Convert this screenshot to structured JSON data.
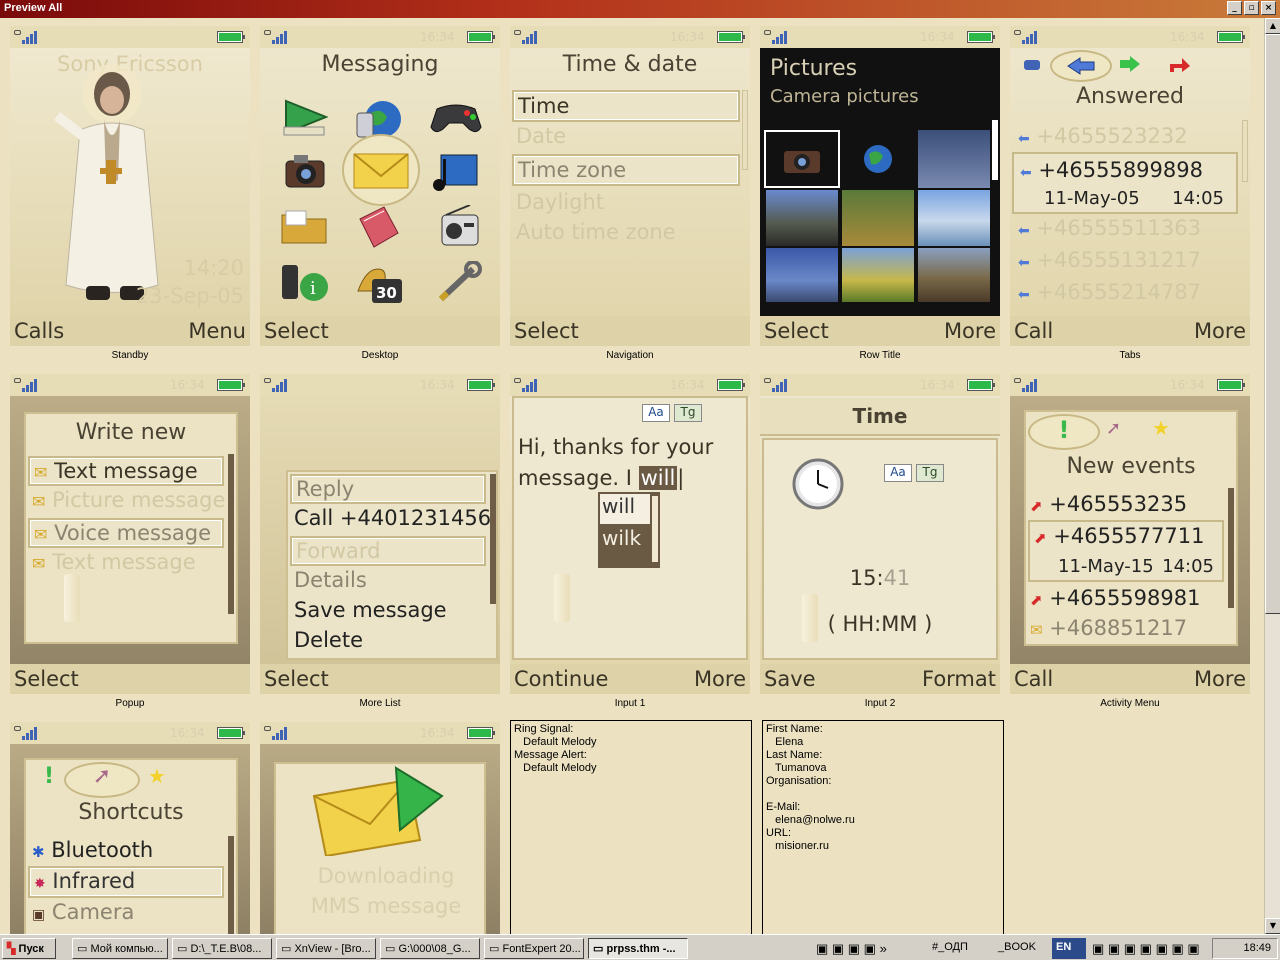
{
  "window": {
    "title": "Preview All",
    "btn_min": "_",
    "btn_max": "▫",
    "btn_close": "×"
  },
  "status_time": "16:34",
  "standby": {
    "brand": "Sony Ericsson",
    "time": "14:20",
    "date": "23-Sep-05",
    "left": "Calls",
    "right": "Menu",
    "caption": "Standby"
  },
  "desktop": {
    "title": "Messaging",
    "left": "Select",
    "caption": "Desktop"
  },
  "navigation": {
    "title": "Time & date",
    "items": [
      "Time",
      "Date",
      "Time zone",
      "Daylight",
      "Auto time zone"
    ],
    "left": "Select",
    "caption": "Navigation"
  },
  "rowtitle": {
    "title": "Pictures",
    "subtitle": "Camera pictures",
    "left": "Select",
    "right": "More",
    "caption": "Row Title"
  },
  "tabs": {
    "title": "Answered",
    "n1": "+4655523232",
    "n2": "+46555899898",
    "n2_date": "11-May-05",
    "n2_time": "14:05",
    "n3": "+46555511363",
    "n4": "+46555131217",
    "n5": "+46555214787",
    "left": "Call",
    "right": "More",
    "caption": "Tabs"
  },
  "popup": {
    "title": "Write new",
    "items": [
      "Text message",
      "Picture message",
      "Voice message",
      "Text message"
    ],
    "left": "Select",
    "caption": "Popup"
  },
  "morelist": {
    "items": [
      "Reply",
      "Call +4401231456",
      "Forward",
      "Details",
      "Save message",
      "Delete"
    ],
    "left": "Select",
    "caption": "More List"
  },
  "input1": {
    "mode1": "Aa",
    "mode2": "Tg",
    "text": "Hi, thanks for your message. I",
    "typed": "will",
    "sugg1": "will",
    "sugg2": "wilk",
    "left": "Continue",
    "right": "More",
    "caption": "Input 1"
  },
  "input2": {
    "title": "Time",
    "mode1": "Aa",
    "mode2": "Tg",
    "value_a": "15:",
    "value_b": "41",
    "format": "( HH:MM )",
    "left": "Save",
    "right": "Format",
    "caption": "Input 2"
  },
  "activity": {
    "title": "New events",
    "n1": "+465553235",
    "n2": "+4655577711",
    "n2_date": "11-May-15",
    "n2_time": "14:05",
    "n3": "+4655598981",
    "n4": "+468851217",
    "left": "Call",
    "right": "More",
    "caption": "Activity Menu"
  },
  "shortcuts": {
    "title": "Shortcuts",
    "items": [
      "Bluetooth",
      "Infrared",
      "Camera"
    ]
  },
  "downloading": {
    "line1": "Downloading",
    "line2": "MMS message"
  },
  "ringtones": {
    "l1": "Ring Signal:",
    "l2": "   Default Melody",
    "l3": "Message Alert:",
    "l4": "   Default Melody"
  },
  "contact": {
    "l1": "First Name:",
    "l2": "   Elena",
    "l3": "Last Name:",
    "l4": "   Tumanova",
    "l5": "Organisation:",
    "l6": "",
    "l7": "E-Mail:",
    "l8": "   elena@nolwe.ru",
    "l9": "URL:",
    "l10": "   misioner.ru"
  },
  "taskbar": {
    "start": "Пуск",
    "items": [
      "Мой компью...",
      "D:\\_T.E.B\\08...",
      "XnView - [Bro...",
      "G:\\000\\08_G...",
      "FontExpert 20...",
      "prpss.thm -..."
    ],
    "tray1": "#_ОДП",
    "tray2": "_BOOK",
    "lang": "EN",
    "time": "18:49"
  }
}
